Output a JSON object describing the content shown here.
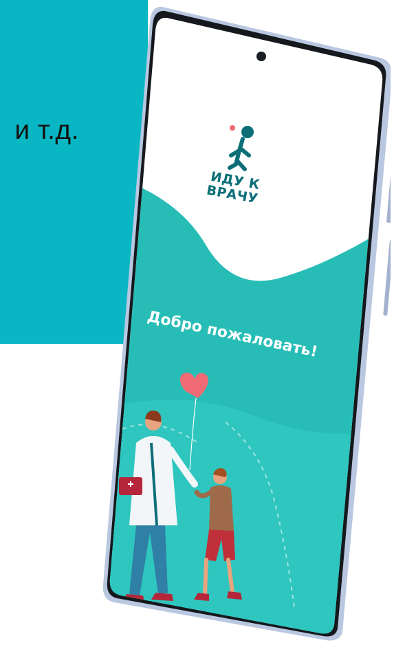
{
  "slide": {
    "caption": "и т.д."
  },
  "app": {
    "logo_line1": "ИДУ К",
    "logo_line2": "ВРАЧУ",
    "welcome": "Добро пожаловать!"
  },
  "colors": {
    "teal_panel": "#08b7c3",
    "app_teal": "#27bdb6",
    "logo_teal": "#0c6f78",
    "heart": "#f06b73",
    "phone_frame": "#b9c7e0"
  }
}
